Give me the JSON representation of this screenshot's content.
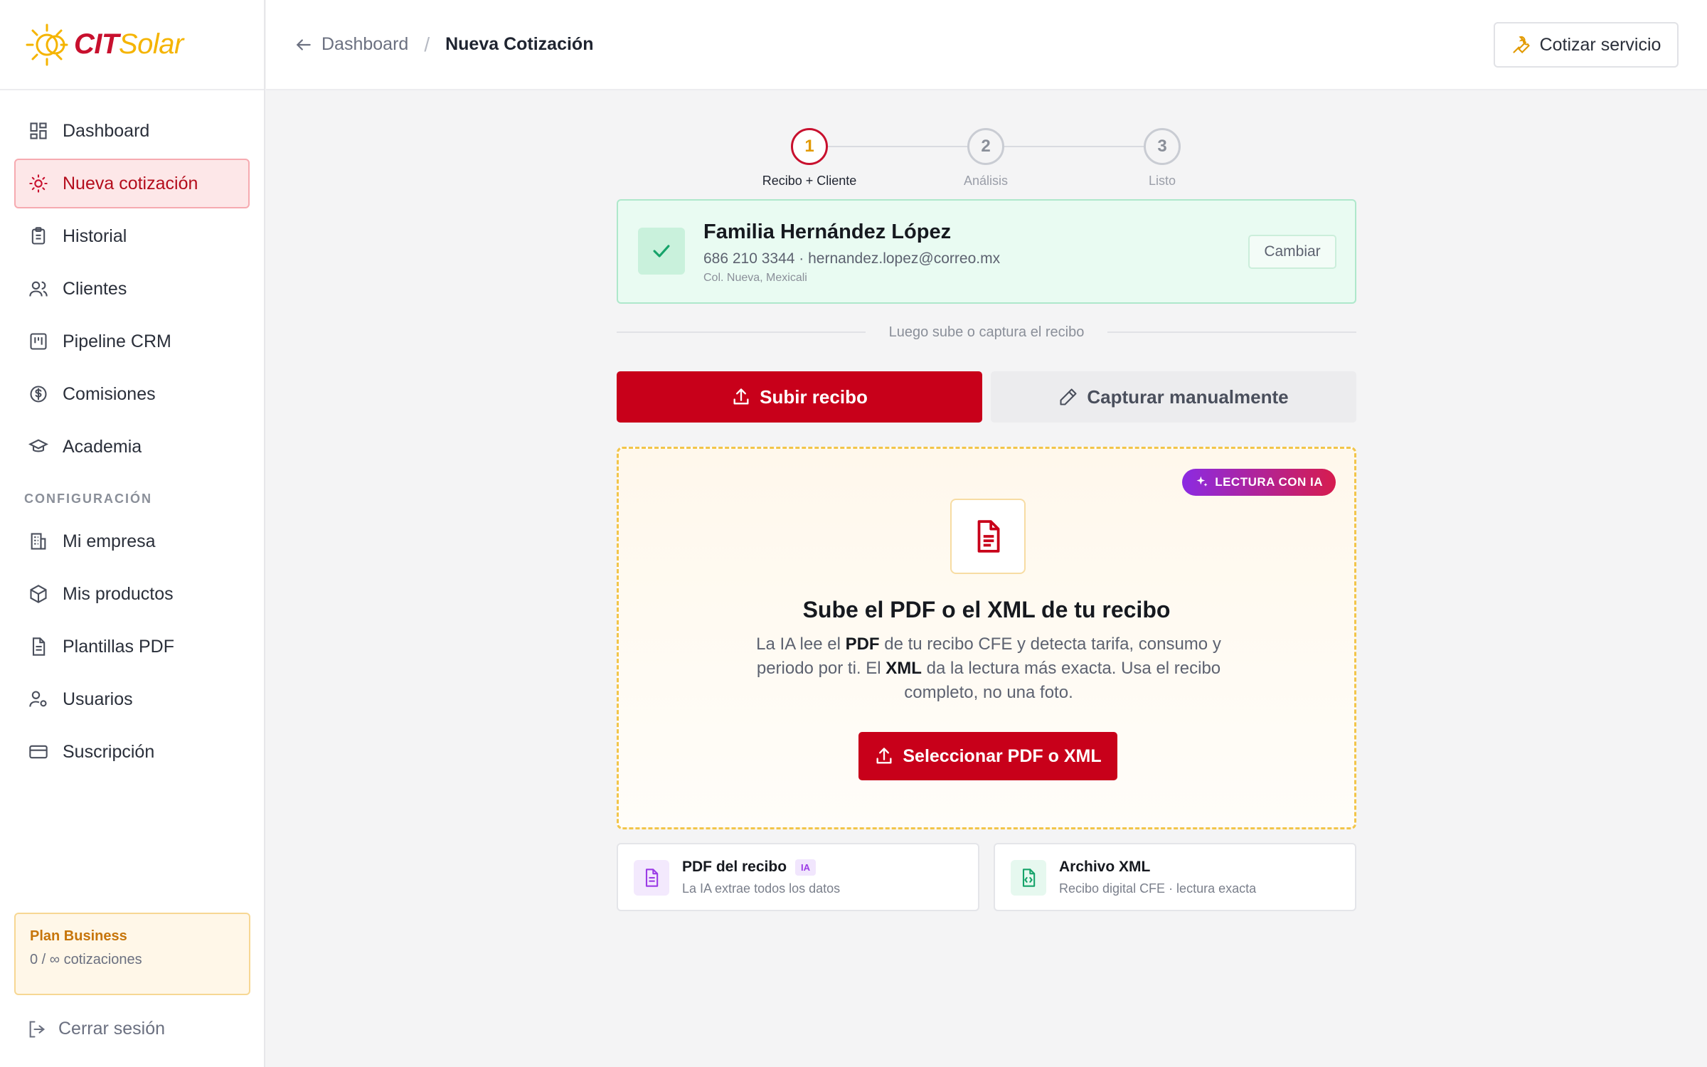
{
  "app": {
    "logo_cit": "CIT",
    "logo_solar": "Solar"
  },
  "sidebar": {
    "items": [
      {
        "label": "Dashboard"
      },
      {
        "label": "Nueva cotización"
      },
      {
        "label": "Historial"
      },
      {
        "label": "Clientes"
      },
      {
        "label": "Pipeline CRM"
      },
      {
        "label": "Comisiones"
      },
      {
        "label": "Academia"
      }
    ],
    "config_label": "CONFIGURACIÓN",
    "config_items": [
      {
        "label": "Mi empresa"
      },
      {
        "label": "Mis productos"
      },
      {
        "label": "Plantillas PDF"
      },
      {
        "label": "Usuarios"
      },
      {
        "label": "Suscripción"
      }
    ],
    "plan": {
      "title": "Plan Business",
      "usage": "0 / ∞ cotizaciones"
    },
    "logout": "Cerrar sesión"
  },
  "header": {
    "back_label": "Dashboard",
    "separator": "/",
    "current": "Nueva Cotización",
    "cta_label": "Cotizar servicio"
  },
  "stepper": {
    "steps": [
      {
        "number": "1",
        "label": "Recibo + Cliente"
      },
      {
        "number": "2",
        "label": "Análisis"
      },
      {
        "number": "3",
        "label": "Listo"
      }
    ]
  },
  "client": {
    "name": "Familia Hernández López",
    "contact": "686 210 3344 · hernandez.lopez@correo.mx",
    "address": "Col. Nueva, Mexicali",
    "change_label": "Cambiar"
  },
  "divider_text": "Luego sube o captura el recibo",
  "mode_buttons": {
    "upload": "Subir recibo",
    "manual": "Capturar manualmente"
  },
  "dropzone": {
    "badge": "LECTURA CON IA",
    "title": "Sube el PDF o el XML de tu recibo",
    "desc_1": "La IA lee el ",
    "desc_pdf": "PDF",
    "desc_2": " de tu recibo CFE y detecta tarifa, consumo y periodo por ti. El ",
    "desc_xml": "XML",
    "desc_3": " da la lectura más exacta. Usa el recibo completo, no una foto.",
    "select_label": "Seleccionar PDF o XML"
  },
  "file_types": [
    {
      "title": "PDF del recibo",
      "tag": "IA",
      "sub": "La IA extrae todos los datos"
    },
    {
      "title": "Archivo XML",
      "sub": "Recibo digital CFE · lectura exacta"
    }
  ],
  "colors": {
    "brand_red": "#c8001a",
    "brand_yellow": "#f5b400",
    "success_green": "#16a36a",
    "ia_purple": "#8b2be2"
  }
}
